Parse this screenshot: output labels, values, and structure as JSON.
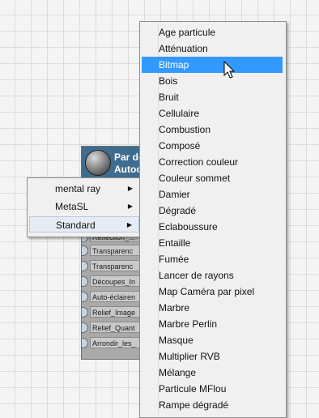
{
  "node": {
    "title_line1": "Par de",
    "title_line2": "Autoc",
    "slots": [
      "Reflection_...",
      "Transparenc",
      "Transparenc",
      "Découpes_In",
      "Auto-éclairen",
      "Relief_Image",
      "Relief_Quant",
      "Arrondir_les_"
    ]
  },
  "submenu": {
    "items": [
      {
        "label": "mental ray",
        "arrow": "▶"
      },
      {
        "label": "MetaSL",
        "arrow": "▶"
      },
      {
        "label": "Standard",
        "arrow": "▶"
      }
    ]
  },
  "menu": {
    "items": [
      "Age particule",
      "Atténuation",
      "Bitmap",
      "Bois",
      "Bruit",
      "Cellulaire",
      "Combustion",
      "Composé",
      "Correction couleur",
      "Couleur sommet",
      "Damier",
      "Dégradé",
      "Eclaboussure",
      "Entaille",
      "Fumée",
      "Lancer de rayons",
      "Map Caméra par pixel",
      "Marbre",
      "Marbre Perlin",
      "Masque",
      "Multiplier RVB",
      "Mélange",
      "Particule MFlou",
      "Rampe dégradé"
    ],
    "highlighted_index": 2,
    "highlight_color": "#3399ff"
  }
}
